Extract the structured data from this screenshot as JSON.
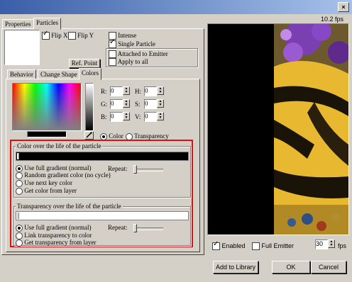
{
  "window": {
    "close_glyph": "×"
  },
  "tabs_top": {
    "properties": "Properties",
    "particles": "Particles"
  },
  "flip_x": {
    "label": "Flip X",
    "checked": true
  },
  "flip_y": {
    "label": "Flip Y",
    "checked": false
  },
  "intense": {
    "label": "Intense",
    "checked": false
  },
  "single_particle": {
    "label": "Single Particle",
    "checked": true
  },
  "attached_to_emitter": {
    "label": "Attached to Emitter",
    "checked": false
  },
  "apply_to_all": {
    "label": "Apply to all",
    "checked": false
  },
  "ref_point_button": "Ref. Point",
  "inner_tabs": {
    "behavior": "Behavior",
    "change_shape": "Change Shape",
    "colors": "Colors"
  },
  "color_fields": {
    "r": {
      "label": "R:",
      "value": "0"
    },
    "g": {
      "label": "G:",
      "value": "0"
    },
    "b": {
      "label": "B:",
      "value": "0"
    },
    "h": {
      "label": "H:",
      "value": "0"
    },
    "s": {
      "label": "S:",
      "value": "0"
    },
    "v": {
      "label": "V:",
      "value": "0"
    }
  },
  "mode": {
    "color": "Color",
    "transparency": "Transparency",
    "selected": "color"
  },
  "color_life": {
    "title": "Color over the life of the particle",
    "repeat_label": "Repeat:",
    "options": [
      "Use full gradient (normal)",
      "Random gradient color (no cycle)",
      "Use next key color",
      "Get color from layer"
    ],
    "selected_index": 0
  },
  "transparency_life": {
    "title": "Transparency over the life of the particle",
    "repeat_label": "Repeat:",
    "options": [
      "Use full gradient (normal)",
      "Link transparency to color",
      "Get transparency from layer"
    ],
    "selected_index": 0
  },
  "preview": {
    "fps_readout": "10.2 fps"
  },
  "enabled": {
    "label": "Enabled",
    "checked": true
  },
  "full_emitter": {
    "label": "Full Emitter",
    "checked": false
  },
  "fps_field": {
    "value": "30",
    "unit": "fps"
  },
  "buttons": {
    "add_to_library": "Add to Library",
    "ok": "OK",
    "cancel": "Cancel"
  },
  "colors": {
    "highlight": "#e01010",
    "titlebar": "#3a5ea8"
  },
  "icons": {
    "eyedropper": "eyedropper-icon",
    "close": "close-icon"
  }
}
